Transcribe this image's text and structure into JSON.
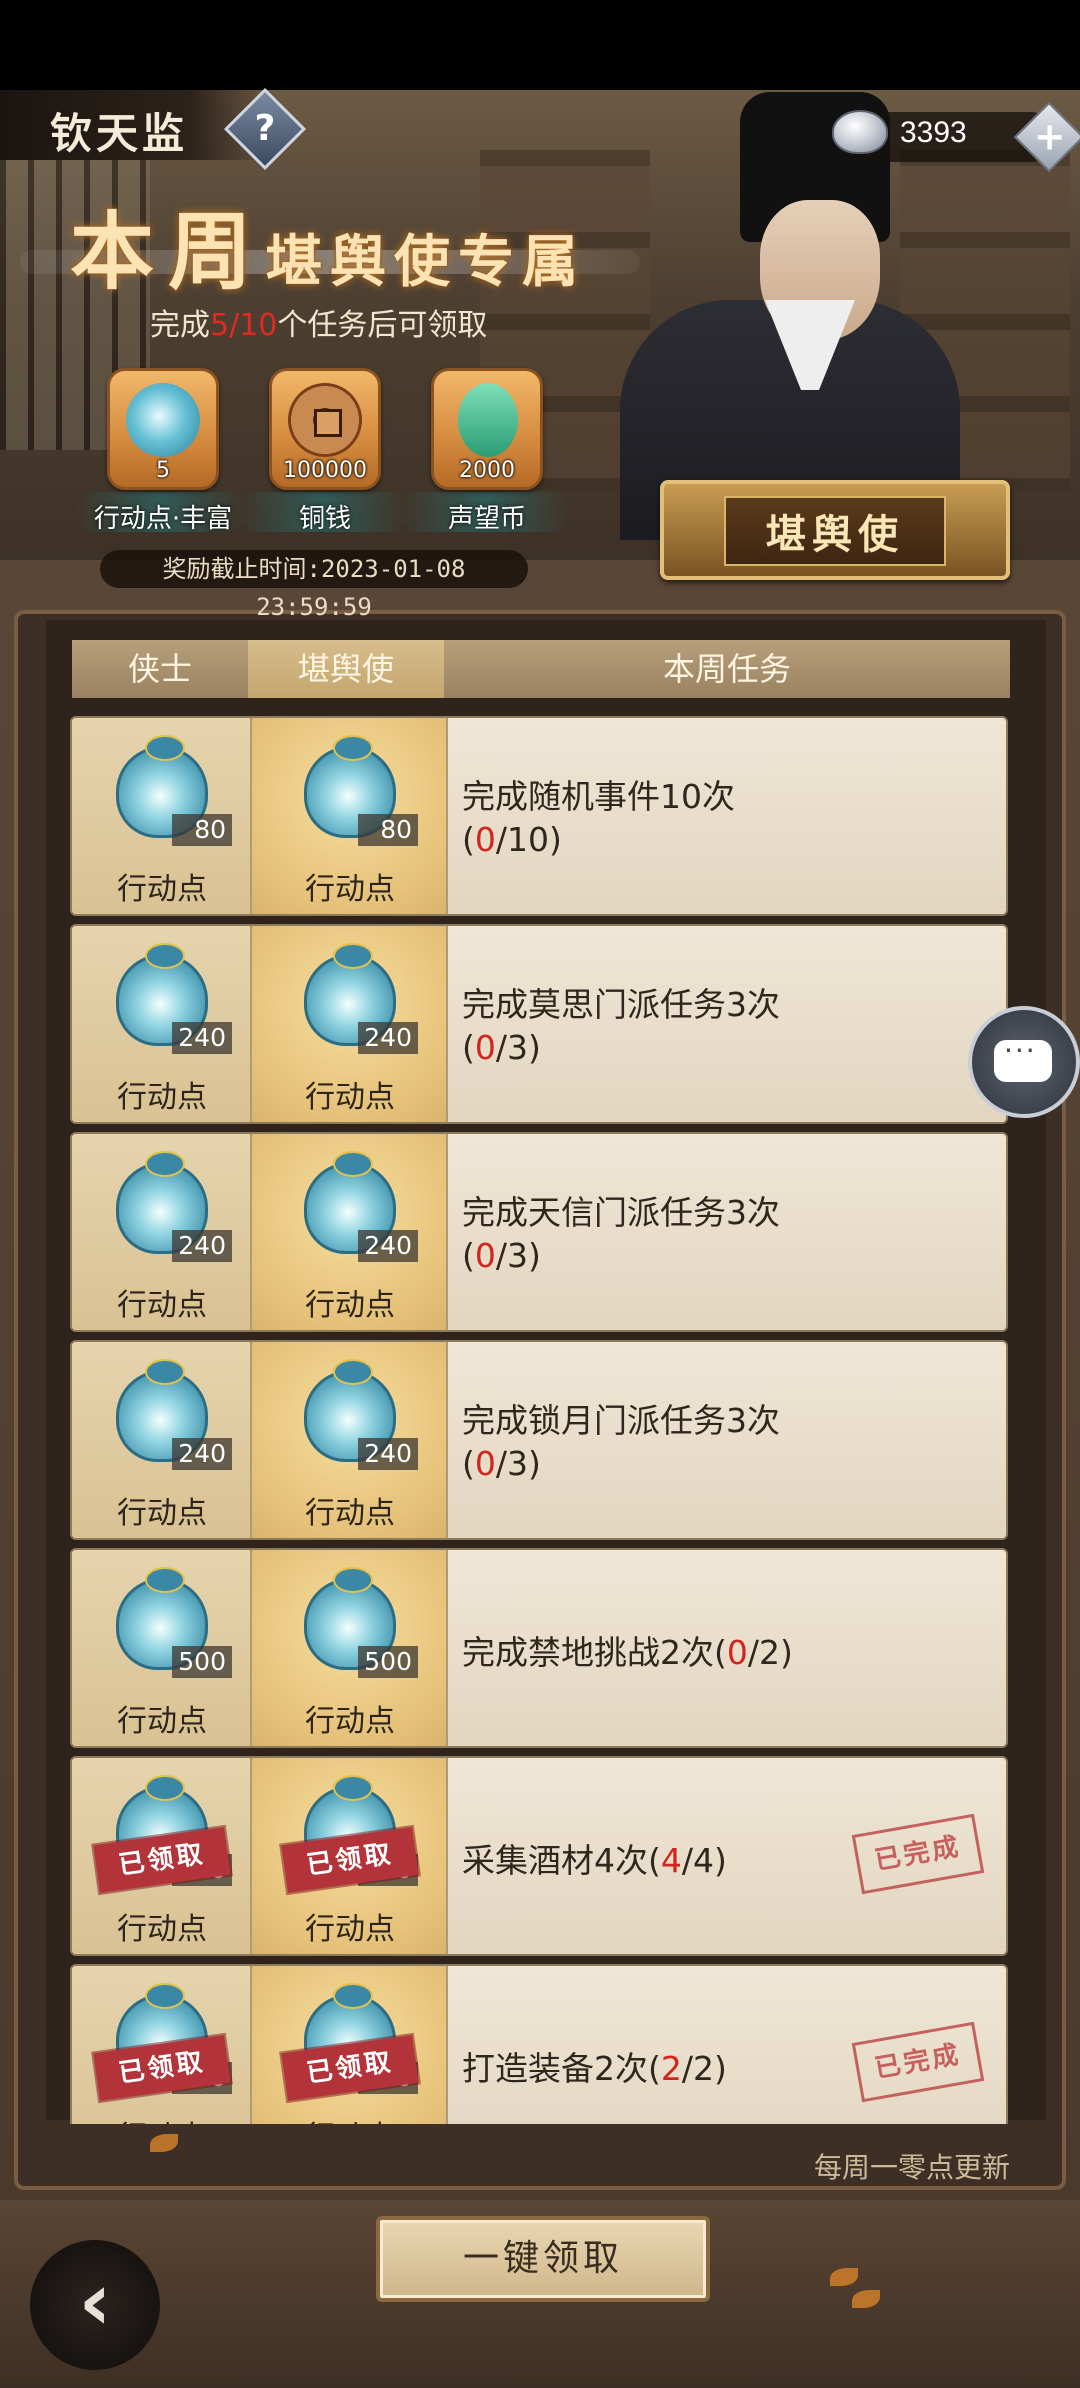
{
  "header": {
    "app_title": "钦天监",
    "help_icon": "question-mark",
    "currency": {
      "icon": "silver-ingot-icon",
      "value": "3393"
    },
    "plus_icon": "plus"
  },
  "banner": {
    "title_big1": "本",
    "title_big2": "周",
    "title_small": "堪舆使专属",
    "condition_prefix": "完成",
    "condition_current": "5",
    "condition_sep": "/",
    "condition_total": "10",
    "condition_suffix": "个任务后可领取",
    "rewards": [
      {
        "icon": "action-point-bag-icon",
        "count": "5",
        "name": "行动点·丰富"
      },
      {
        "icon": "copper-coin-icon",
        "count": "100000",
        "name": "铜钱"
      },
      {
        "icon": "prestige-coin-icon",
        "count": "2000",
        "name": "声望币"
      }
    ],
    "deadline": "奖励截止时间:2023-01-08 23:59:59",
    "role_plaque": "堪舆使"
  },
  "table": {
    "col1": "侠士",
    "col2": "堪舆使",
    "col3": "本周任务"
  },
  "tasks": [
    {
      "reward1_qty": "80",
      "reward1_label": "行动点",
      "reward2_qty": "80",
      "reward2_label": "行动点",
      "name": "完成随机事件10次",
      "progress_open": "(",
      "progress_cur": "0",
      "progress_rest": "/10)",
      "claimed": false
    },
    {
      "reward1_qty": "240",
      "reward1_label": "行动点",
      "reward2_qty": "240",
      "reward2_label": "行动点",
      "name": "完成莫思门派任务3次",
      "progress_open": "(",
      "progress_cur": "0",
      "progress_rest": "/3)",
      "claimed": false
    },
    {
      "reward1_qty": "240",
      "reward1_label": "行动点",
      "reward2_qty": "240",
      "reward2_label": "行动点",
      "name": "完成天信门派任务3次",
      "progress_open": "(",
      "progress_cur": "0",
      "progress_rest": "/3)",
      "claimed": false
    },
    {
      "reward1_qty": "240",
      "reward1_label": "行动点",
      "reward2_qty": "240",
      "reward2_label": "行动点",
      "name": "完成锁月门派任务3次",
      "progress_open": "(",
      "progress_cur": "0",
      "progress_rest": "/3)",
      "claimed": false
    },
    {
      "reward1_qty": "500",
      "reward1_label": "行动点",
      "reward2_qty": "500",
      "reward2_label": "行动点",
      "name": "完成禁地挑战2次",
      "progress_open": "(",
      "progress_cur": "0",
      "progress_rest": "/2)",
      "claimed": false
    },
    {
      "reward1_qty": "320",
      "reward1_label": "行动点",
      "reward2_qty": "320",
      "reward2_label": "行动点",
      "name": "采集酒材4次",
      "progress_open": "(",
      "progress_cur": "4",
      "progress_rest": "/4)",
      "claimed": true,
      "claimed_label": "已领取",
      "done_label": "已完成"
    },
    {
      "reward1_qty": "450",
      "reward1_label": "行动点",
      "reward2_qty": "450",
      "reward2_label": "行动点",
      "name": "打造装备2次",
      "progress_open": "(",
      "progress_cur": "2",
      "progress_rest": "/2)",
      "claimed": true,
      "claimed_label": "已领取",
      "done_label": "已完成"
    }
  ],
  "footer": {
    "refresh_note": "每周一零点更新",
    "claim_all": "一键领取",
    "back_icon": "back-arrow",
    "chat_icon": "chat-bubble"
  }
}
